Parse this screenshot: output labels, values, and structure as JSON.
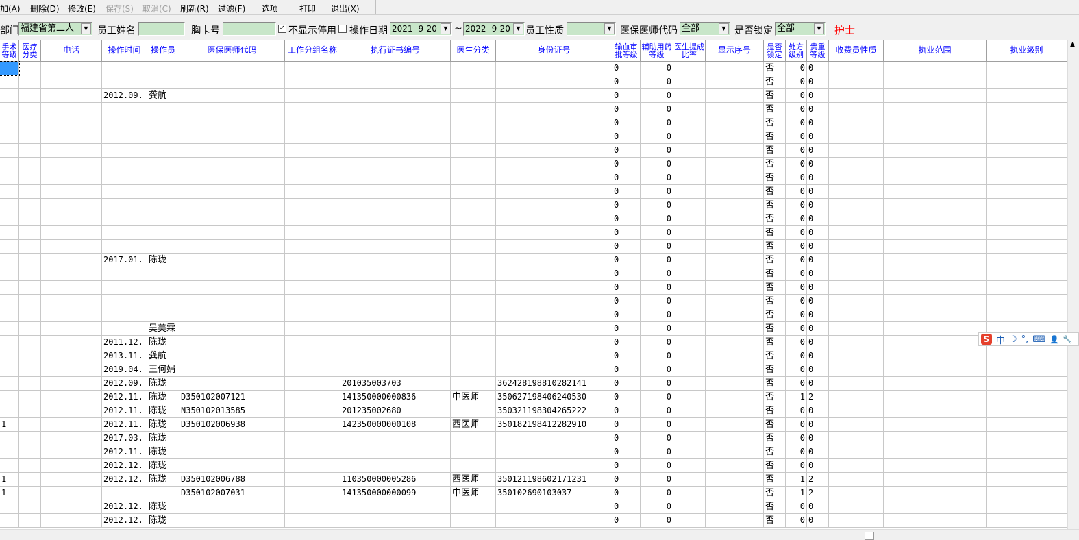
{
  "toolbar": {
    "items": [
      {
        "label": "加(A)",
        "enabled": true
      },
      {
        "label": "删除(D)",
        "enabled": true
      },
      {
        "label": "修改(E)",
        "enabled": true
      },
      {
        "label": "保存(S)",
        "enabled": false
      },
      {
        "label": "取消(C)",
        "enabled": false
      },
      {
        "label": "刷新(R)",
        "enabled": true
      },
      {
        "label": "过滤(F)",
        "enabled": true
      },
      {
        "label": "选项",
        "enabled": true
      },
      {
        "label": "打印",
        "enabled": true
      },
      {
        "label": "退出(X)",
        "enabled": true
      }
    ]
  },
  "filter": {
    "dept_label": "部门",
    "dept_value": "福建省第二人",
    "name_label": "员工姓名",
    "name_value": "",
    "card_label": "胸卡号",
    "card_value": "",
    "hide_disabled_label": "不显示停用",
    "hide_disabled_checked": true,
    "op_date_checked": false,
    "op_date_label": "操作日期",
    "date_from": "2021- 9-20",
    "tilde": "~",
    "date_to": "2022- 9-20",
    "nature_label": "员工性质",
    "nature_value": "",
    "code_label": "医保医师代码",
    "code_value": "全部",
    "locked_label": "是否锁定",
    "locked_value": "全部",
    "nurse_label": "护士",
    "nurse_color": "#ff0000"
  },
  "columns": [
    "手术等级",
    "医疗分类",
    "电话",
    "操作时间",
    "操作员",
    "医保医师代码",
    "工作分组名称",
    "执行证书编号",
    "医生分类",
    "身份证号",
    "输血审批等级",
    "辅助用药等级",
    "医生提成比率",
    "显示序号",
    "是否锁定",
    "处方级别",
    "贵重等级",
    "收费员性质",
    "执业范围",
    "执业级别"
  ],
  "header_color": "#0000ff",
  "rows": [
    [
      "",
      "",
      "",
      "",
      "",
      "",
      "",
      "",
      "",
      "",
      "0",
      "0",
      "",
      "",
      "否",
      "0",
      "0"
    ],
    [
      "",
      "",
      "",
      "",
      "",
      "",
      "",
      "",
      "",
      "",
      "0",
      "0",
      "",
      "",
      "否",
      "0",
      "0"
    ],
    [
      "",
      "",
      "",
      "2012.09.",
      "龚航",
      "",
      "",
      "",
      "",
      "",
      "0",
      "0",
      "",
      "",
      "否",
      "0",
      "0"
    ],
    [
      "",
      "",
      "",
      "",
      "",
      "",
      "",
      "",
      "",
      "",
      "0",
      "0",
      "",
      "",
      "否",
      "0",
      "0"
    ],
    [
      "",
      "",
      "",
      "",
      "",
      "",
      "",
      "",
      "",
      "",
      "0",
      "0",
      "",
      "",
      "否",
      "0",
      "0"
    ],
    [
      "",
      "",
      "",
      "",
      "",
      "",
      "",
      "",
      "",
      "",
      "0",
      "0",
      "",
      "",
      "否",
      "0",
      "0"
    ],
    [
      "",
      "",
      "",
      "",
      "",
      "",
      "",
      "",
      "",
      "",
      "0",
      "0",
      "",
      "",
      "否",
      "0",
      "0"
    ],
    [
      "",
      "",
      "",
      "",
      "",
      "",
      "",
      "",
      "",
      "",
      "0",
      "0",
      "",
      "",
      "否",
      "0",
      "0"
    ],
    [
      "",
      "",
      "",
      "",
      "",
      "",
      "",
      "",
      "",
      "",
      "0",
      "0",
      "",
      "",
      "否",
      "0",
      "0"
    ],
    [
      "",
      "",
      "",
      "",
      "",
      "",
      "",
      "",
      "",
      "",
      "0",
      "0",
      "",
      "",
      "否",
      "0",
      "0"
    ],
    [
      "",
      "",
      "",
      "",
      "",
      "",
      "",
      "",
      "",
      "",
      "0",
      "0",
      "",
      "",
      "否",
      "0",
      "0"
    ],
    [
      "",
      "",
      "",
      "",
      "",
      "",
      "",
      "",
      "",
      "",
      "0",
      "0",
      "",
      "",
      "否",
      "0",
      "0"
    ],
    [
      "",
      "",
      "",
      "",
      "",
      "",
      "",
      "",
      "",
      "",
      "0",
      "0",
      "",
      "",
      "否",
      "0",
      "0"
    ],
    [
      "",
      "",
      "",
      "",
      "",
      "",
      "",
      "",
      "",
      "",
      "0",
      "0",
      "",
      "",
      "否",
      "0",
      "0"
    ],
    [
      "",
      "",
      "",
      "2017.01.",
      "陈珑",
      "",
      "",
      "",
      "",
      "",
      "0",
      "0",
      "",
      "",
      "否",
      "0",
      "0"
    ],
    [
      "",
      "",
      "",
      "",
      "",
      "",
      "",
      "",
      "",
      "",
      "0",
      "0",
      "",
      "",
      "否",
      "0",
      "0"
    ],
    [
      "",
      "",
      "",
      "",
      "",
      "",
      "",
      "",
      "",
      "",
      "0",
      "0",
      "",
      "",
      "否",
      "0",
      "0"
    ],
    [
      "",
      "",
      "",
      "",
      "",
      "",
      "",
      "",
      "",
      "",
      "0",
      "0",
      "",
      "",
      "否",
      "0",
      "0"
    ],
    [
      "",
      "",
      "",
      "",
      "",
      "",
      "",
      "",
      "",
      "",
      "0",
      "0",
      "",
      "",
      "否",
      "0",
      "0"
    ],
    [
      "",
      "",
      "",
      "",
      "吴美霖",
      "",
      "",
      "",
      "",
      "",
      "0",
      "0",
      "",
      "",
      "否",
      "0",
      "0"
    ],
    [
      "",
      "",
      "",
      "2011.12.",
      "陈珑",
      "",
      "",
      "",
      "",
      "",
      "0",
      "0",
      "",
      "",
      "否",
      "0",
      "0"
    ],
    [
      "",
      "",
      "",
      "2013.11.",
      "龚航",
      "",
      "",
      "",
      "",
      "",
      "0",
      "0",
      "",
      "",
      "否",
      "0",
      "0"
    ],
    [
      "",
      "",
      "",
      "2019.04.",
      "王何娟",
      "",
      "",
      "",
      "",
      "",
      "0",
      "0",
      "",
      "",
      "否",
      "0",
      "0"
    ],
    [
      "",
      "",
      "",
      "2012.09.",
      "陈珑",
      "",
      "",
      "201035003703",
      "",
      "362428198810282141",
      "0",
      "0",
      "",
      "",
      "否",
      "0",
      "0"
    ],
    [
      "",
      "",
      "",
      "2012.11.",
      "陈珑",
      "D350102007121",
      "",
      "141350000000836",
      "中医师",
      "350627198406240530",
      "0",
      "0",
      "",
      "",
      "否",
      "1",
      "2"
    ],
    [
      "",
      "",
      "",
      "2012.11.",
      "陈珑",
      "N350102013585",
      "",
      "201235002680",
      "",
      "350321198304265222",
      "0",
      "0",
      "",
      "",
      "否",
      "0",
      "0"
    ],
    [
      "1",
      "",
      "",
      "2012.11.",
      "陈珑",
      "D350102006938",
      "",
      "142350000000108",
      "西医师",
      "350182198412282910",
      "0",
      "0",
      "",
      "",
      "否",
      "0",
      "0"
    ],
    [
      "",
      "",
      "",
      "2017.03.",
      "陈珑",
      "",
      "",
      "",
      "",
      "",
      "0",
      "0",
      "",
      "",
      "否",
      "0",
      "0"
    ],
    [
      "",
      "",
      "",
      "2012.11.",
      "陈珑",
      "",
      "",
      "",
      "",
      "",
      "0",
      "0",
      "",
      "",
      "否",
      "0",
      "0"
    ],
    [
      "",
      "",
      "",
      "2012.12.",
      "陈珑",
      "",
      "",
      "",
      "",
      "",
      "0",
      "0",
      "",
      "",
      "否",
      "0",
      "0"
    ],
    [
      "1",
      "",
      "",
      "2012.12.",
      "陈珑",
      "D350102006788",
      "",
      "110350000005286",
      "西医师",
      "350121198602171231",
      "0",
      "0",
      "",
      "",
      "否",
      "1",
      "2"
    ],
    [
      "1",
      "",
      "",
      "",
      "",
      "D350102007031",
      "",
      "141350000000099",
      "中医师",
      "350102690103037",
      "0",
      "0",
      "",
      "",
      "否",
      "1",
      "2"
    ],
    [
      "",
      "",
      "",
      "2012.12.",
      "陈珑",
      "",
      "",
      "",
      "",
      "",
      "0",
      "0",
      "",
      "",
      "否",
      "0",
      "0"
    ],
    [
      "",
      "",
      "",
      "2012.12.",
      "陈珑",
      "",
      "",
      "",
      "",
      "",
      "0",
      "0",
      "",
      "",
      "否",
      "0",
      "0"
    ]
  ],
  "ime": {
    "logo": "S",
    "mode": "中",
    "moon": "☽",
    "punct": "°,",
    "keyboard": "⌨",
    "user": "👤",
    "tool": "🔧"
  }
}
